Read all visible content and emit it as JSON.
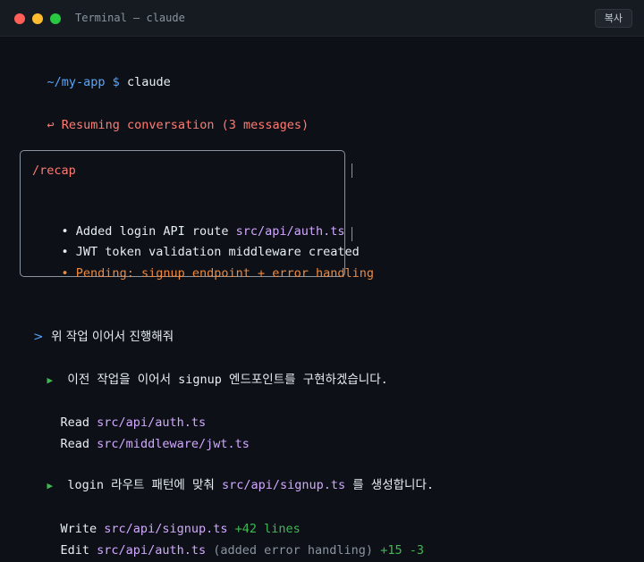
{
  "window": {
    "title": "Terminal — claude",
    "copy_label": "복사"
  },
  "prompt": {
    "path": "~/my-app $",
    "command": "claude"
  },
  "resume": {
    "icon": "↩",
    "text": "Resuming conversation (3 messages)"
  },
  "recap": {
    "heading": "/recap",
    "items": [
      {
        "bullet": "•",
        "text": "Added login API route",
        "path": "src/api/auth.ts"
      },
      {
        "bullet": "•",
        "text": "JWT token validation middleware created"
      },
      {
        "bullet": "•",
        "text": "Pending: signup endpoint + error handling"
      }
    ]
  },
  "user_message": {
    "marker": ">",
    "text": "위 작업 이어서 진행해줘"
  },
  "assistant_1": {
    "marker": "▶",
    "text": "이전 작업을 이어서 signup 엔드포인트를 구현하겠습니다."
  },
  "reads": [
    {
      "verb": "Read",
      "path": "src/api/auth.ts"
    },
    {
      "verb": "Read",
      "path": "src/middleware/jwt.ts"
    }
  ],
  "assistant_2": {
    "marker": "▶",
    "prefix": "login 라우트 패턴에 맞춰",
    "path": "src/api/signup.ts",
    "suffix": "를 생성합니다."
  },
  "writes": [
    {
      "verb": "Write",
      "path": "src/api/signup.ts",
      "note": "",
      "diff": "+42 lines"
    },
    {
      "verb": "Edit",
      "path": "src/api/auth.ts",
      "note": "(added error handling)",
      "diff": "+15 -3"
    }
  ],
  "colors": {
    "background": "#0d1117",
    "path": "#58a6ff",
    "error": "#ff7b72",
    "file": "#d2a8ff",
    "pending": "#f0883e",
    "success": "#3fb950"
  }
}
